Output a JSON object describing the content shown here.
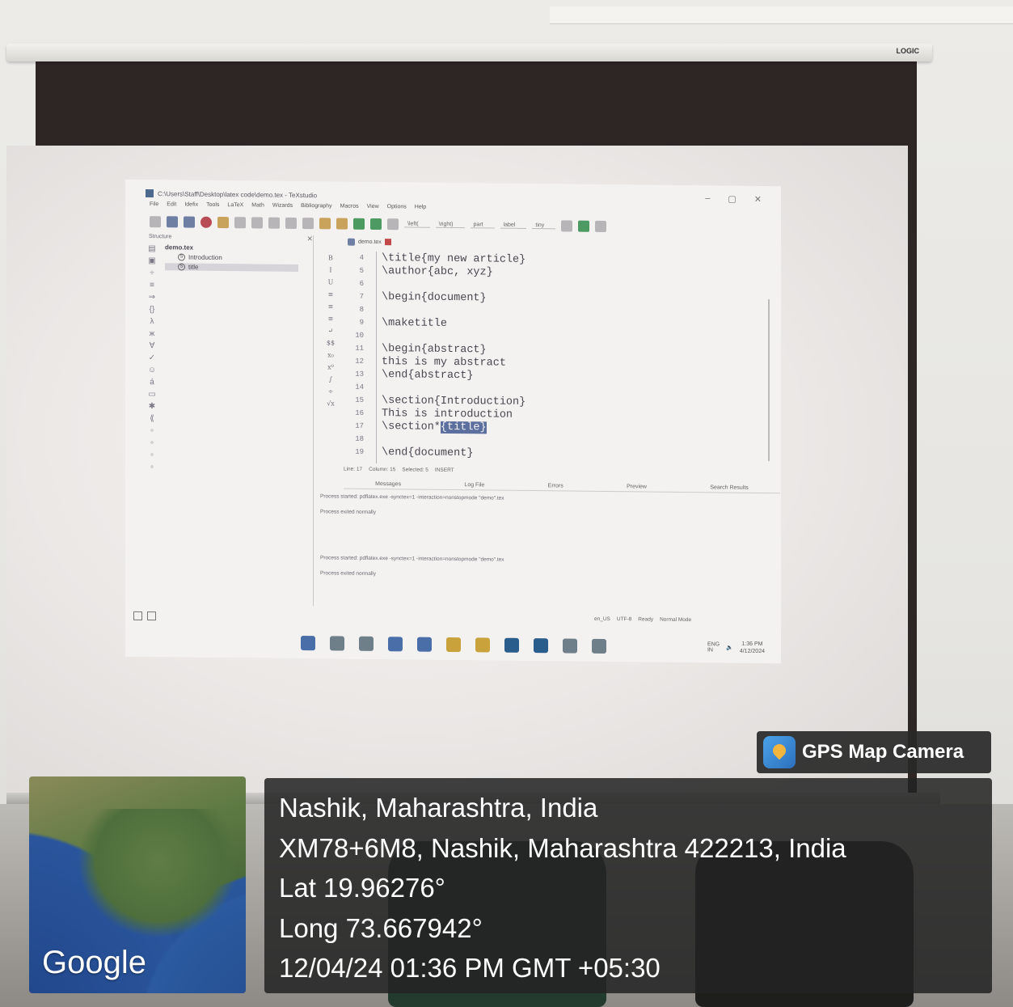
{
  "projector": {
    "brand": "LOGIC"
  },
  "app": {
    "window_title": "C:\\Users\\Staff\\Desktop\\latex code\\demo.tex - TeXstudio",
    "menu": [
      "File",
      "Edit",
      "Idefix",
      "Tools",
      "LaTeX",
      "Math",
      "Wizards",
      "Bibliography",
      "Macros",
      "View",
      "Options",
      "Help"
    ],
    "toolbar_combos": [
      "\\left(",
      "\\right)",
      "part",
      "label",
      "tiny"
    ],
    "structure": {
      "header": "Structure",
      "root": "demo.tex",
      "items": [
        "Introduction",
        "title"
      ]
    },
    "editor_tab": "demo.tex",
    "lines": [
      {
        "n": "4",
        "text": "\\title{my new article}"
      },
      {
        "n": "5",
        "text": "\\author{abc, xyz}"
      },
      {
        "n": "6",
        "text": ""
      },
      {
        "n": "7",
        "text": "\\begin{document}"
      },
      {
        "n": "8",
        "text": ""
      },
      {
        "n": "9",
        "text": "\\maketitle"
      },
      {
        "n": "10",
        "text": ""
      },
      {
        "n": "11",
        "text": "\\begin{abstract}"
      },
      {
        "n": "12",
        "text": "this is my abstract"
      },
      {
        "n": "13",
        "text": "\\end{abstract}"
      },
      {
        "n": "14",
        "text": ""
      },
      {
        "n": "15",
        "text": "\\section{Introduction}"
      },
      {
        "n": "16",
        "text": "This is introduction"
      },
      {
        "n": "17",
        "text": "\\section*",
        "highlight": "{title}"
      },
      {
        "n": "18",
        "text": ""
      },
      {
        "n": "19",
        "text": "\\end{document}"
      }
    ],
    "status": {
      "line": "Line: 17",
      "column": "Column: 15",
      "selected": "Selected: 5",
      "mode": "INSERT"
    },
    "panel_tabs": [
      "Messages",
      "Log File",
      "Errors",
      "Preview",
      "Search Results"
    ],
    "messages": [
      "Process started: pdflatex.exe -synctex=1 -interaction=nonstopmode \"demo\".tex",
      "Process exited normally",
      "Process started: pdflatex.exe -synctex=1 -interaction=nonstopmode \"demo\".tex",
      "Process exited normally"
    ],
    "bottom_status": [
      "en_US",
      "UTF-8",
      "Ready",
      "Normal Mode"
    ],
    "tray": {
      "lang": "ENG",
      "region": "IN",
      "time": "1:36 PM",
      "date": "4/12/2024"
    }
  },
  "gps": {
    "app_name": "GPS Map Camera",
    "map_brand": "Google",
    "place": "Nashik, Maharashtra, India",
    "address": "XM78+6M8, Nashik, Maharashtra 422213, India",
    "lat": "Lat 19.96276°",
    "long": "Long 73.667942°",
    "datetime": "12/04/24 01:36 PM GMT +05:30"
  }
}
